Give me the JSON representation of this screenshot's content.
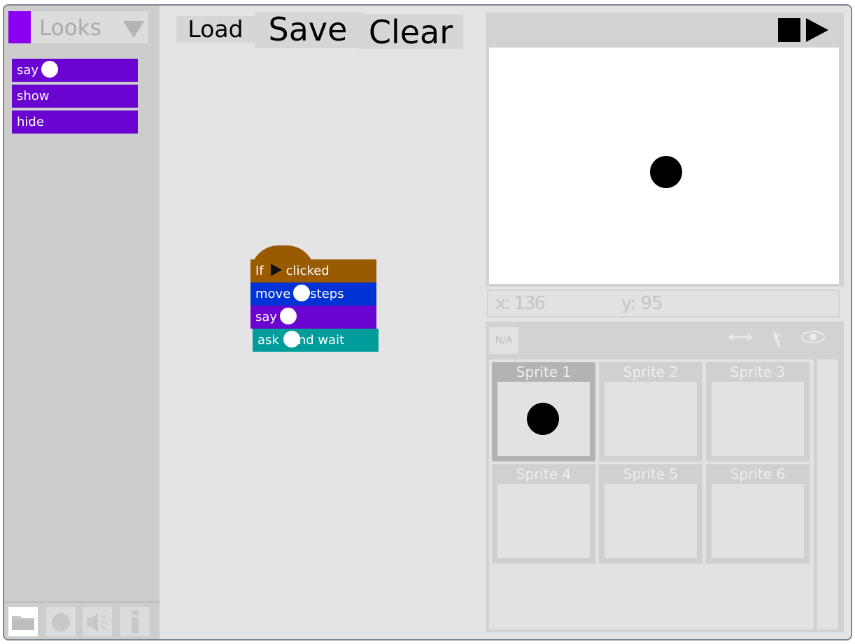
{
  "palette": {
    "category_label": "Looks",
    "category_color": "#8b00f0",
    "blocks": [
      {
        "label": "say",
        "has_slot": true
      },
      {
        "label": "show",
        "has_slot": false
      },
      {
        "label": "hide",
        "has_slot": false
      }
    ],
    "tools": [
      "folder-icon",
      "record-icon",
      "sound-icon",
      "info-icon"
    ]
  },
  "toolbar": {
    "load": "Load",
    "save": "Save",
    "clear": "Clear"
  },
  "script": {
    "hat": {
      "pre": "If",
      "post": "clicked"
    },
    "move": {
      "pre": "move",
      "post": "steps"
    },
    "say": {
      "pre": "say"
    },
    "ask": {
      "pre": "ask",
      "post": "and wait"
    }
  },
  "stage": {
    "x_label": "x:",
    "x_value": "136",
    "y_label": "y:",
    "y_value": "95"
  },
  "sprite_panel": {
    "na_label": "N/A",
    "sprites": [
      "Sprite 1",
      "Sprite 2",
      "Sprite 3",
      "Sprite 4",
      "Sprite 5",
      "Sprite 6"
    ],
    "selected": "Sprite 1"
  },
  "colors": {
    "looks": "#6a04d0",
    "motion": "#0032d6",
    "events": "#9a5a00",
    "sensing": "#009c9c"
  }
}
